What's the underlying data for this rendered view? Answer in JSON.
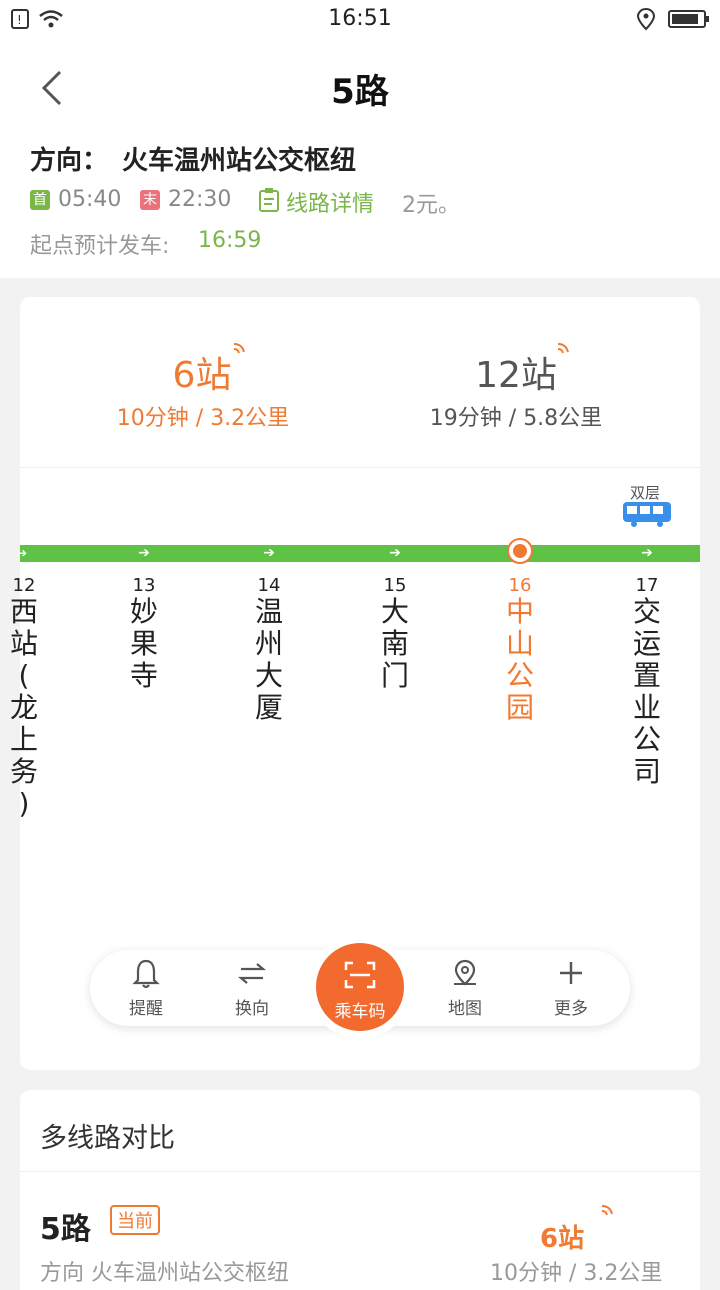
{
  "status_bar": {
    "time": "16:51"
  },
  "header": {
    "title": "5路",
    "direction_label": "方向：",
    "direction_value": "火车温州站公交枢纽",
    "first_tag": "首",
    "first_time": "05:40",
    "last_tag": "末",
    "last_time": "22:30",
    "detail_label": "线路详情",
    "fare": "2元。",
    "depart_label": "起点预计发车:",
    "depart_time": "16:59"
  },
  "eta": [
    {
      "stops": "6站",
      "sub": "10分钟 / 3.2公里"
    },
    {
      "stops": "12站",
      "sub": "19分钟 / 5.8公里"
    }
  ],
  "bus_type_label": "双层",
  "stations": [
    {
      "num": "12",
      "name": [
        "西",
        "站",
        "(",
        "龙",
        "上",
        "务",
        ")"
      ]
    },
    {
      "num": "13",
      "name": [
        "妙",
        "果",
        "寺"
      ]
    },
    {
      "num": "14",
      "name": [
        "温",
        "州",
        "大",
        "厦"
      ]
    },
    {
      "num": "15",
      "name": [
        "大",
        "南",
        "门"
      ]
    },
    {
      "num": "16",
      "name": [
        "中",
        "山",
        "公",
        "园"
      ]
    },
    {
      "num": "17",
      "name": [
        "交",
        "运",
        "置",
        "业",
        "公",
        "司"
      ]
    }
  ],
  "nav": {
    "remind": "提醒",
    "switch": "换向",
    "qr": "乘车码",
    "map": "地图",
    "more": "更多"
  },
  "compare": {
    "title": "多线路对比",
    "route": "5路",
    "badge": "当前",
    "direction": "方向 火车温州站公交枢纽",
    "eta_stops": "6站",
    "eta_sub": "10分钟 / 3.2公里"
  },
  "colors": {
    "accent": "#f07a32",
    "line": "#5dc245",
    "detail": "#7ab648"
  }
}
